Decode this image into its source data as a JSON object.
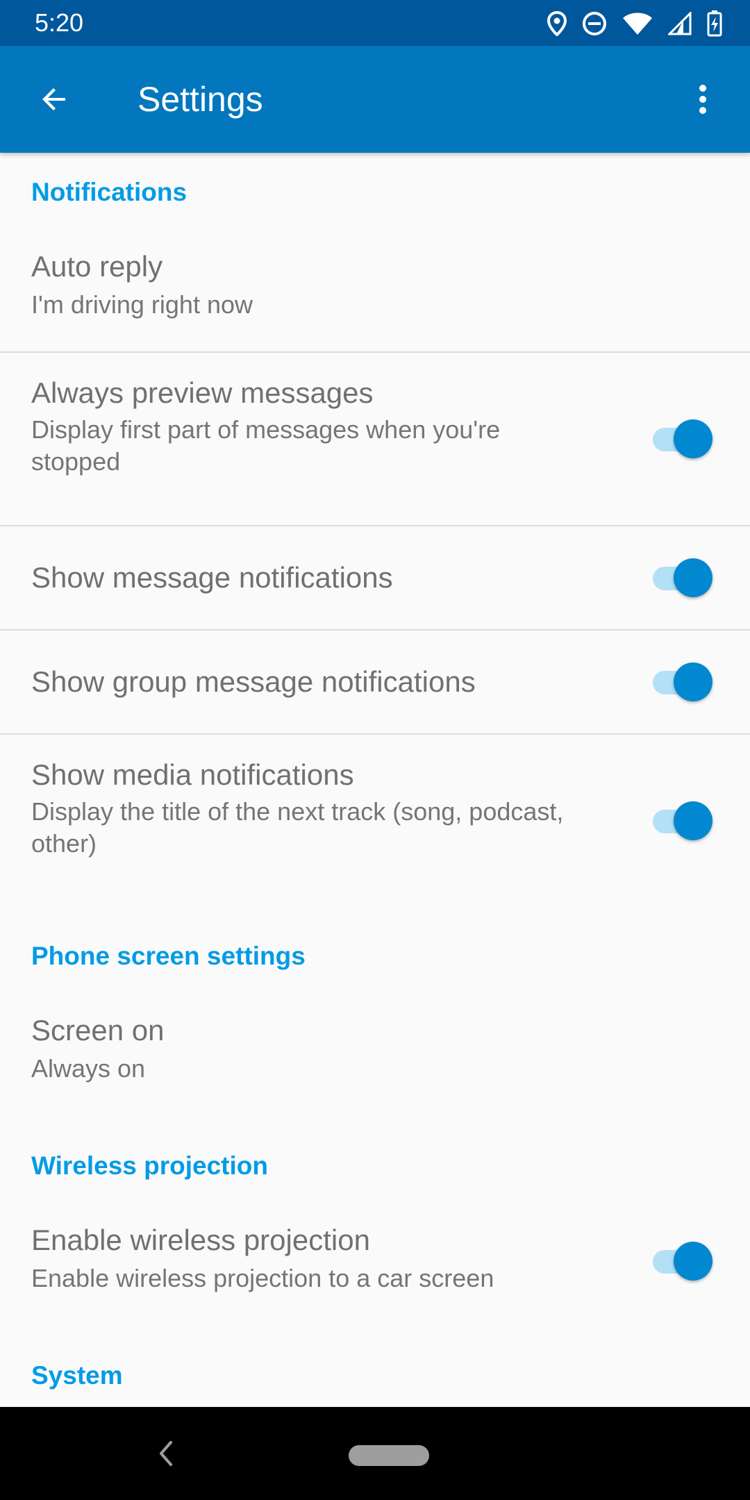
{
  "status_bar": {
    "time": "5:20",
    "icons": [
      "location-icon",
      "do-not-disturb-icon",
      "wifi-icon",
      "signal-icon",
      "battery-charging-icon"
    ]
  },
  "app_bar": {
    "title": "Settings",
    "back_icon": "arrow-back-icon",
    "menu_icon": "more-vert-icon"
  },
  "colors": {
    "status_bar": "#01579b",
    "app_bar": "#0277bd",
    "accent": "#039be5",
    "toggle_on": "#0288d1"
  },
  "sections": {
    "notifications": {
      "header": "Notifications",
      "auto_reply": {
        "title": "Auto reply",
        "summary": "I'm driving right now"
      },
      "always_preview": {
        "title": "Always preview messages",
        "summary": "Display first part of messages when you're stopped",
        "enabled": true
      },
      "message_notifications": {
        "title": "Show message notifications",
        "enabled": true
      },
      "group_notifications": {
        "title": "Show group message notifications",
        "enabled": true
      },
      "media_notifications": {
        "title": "Show media notifications",
        "summary": "Display the title of the next track (song, podcast, other)",
        "enabled": true
      }
    },
    "phone_screen": {
      "header": "Phone screen settings",
      "screen_on": {
        "title": "Screen on",
        "summary": "Always on"
      }
    },
    "wireless": {
      "header": "Wireless projection",
      "enable": {
        "title": "Enable wireless projection",
        "summary": "Enable wireless projection to a car screen",
        "enabled": true
      }
    },
    "system": {
      "header": "System"
    }
  },
  "nav_bar": {
    "back_icon": "nav-back-icon",
    "home_icon": "home-pill-icon"
  }
}
